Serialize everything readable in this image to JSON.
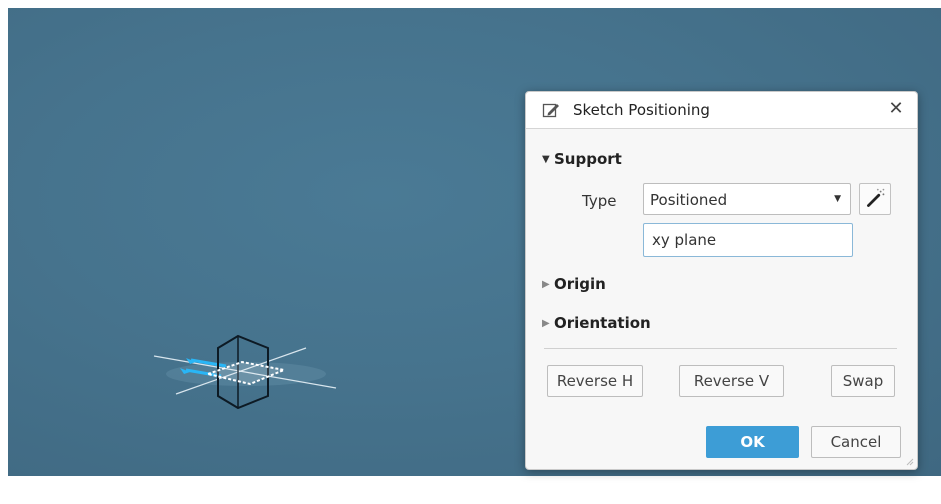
{
  "dialog": {
    "title": "Sketch Positioning",
    "close_glyph": "✕",
    "icons": {
      "title": "sketch-edit-icon",
      "wand": "magic-wand-icon",
      "close": "close-icon"
    },
    "support": {
      "label": "Support",
      "expanded": true,
      "type_label": "Type",
      "type_value": "Positioned",
      "reference_value": "xy plane"
    },
    "origin": {
      "label": "Origin",
      "expanded": false
    },
    "orientation": {
      "label": "Orientation",
      "expanded": false
    },
    "buttons": {
      "reverse_h": "Reverse H",
      "reverse_v": "Reverse V",
      "swap": "Swap",
      "ok": "OK",
      "cancel": "Cancel"
    }
  },
  "colors": {
    "viewport_bg": "#46738d",
    "accent": "#3d9dd6",
    "gizmo_axis": "#29b6f6"
  }
}
